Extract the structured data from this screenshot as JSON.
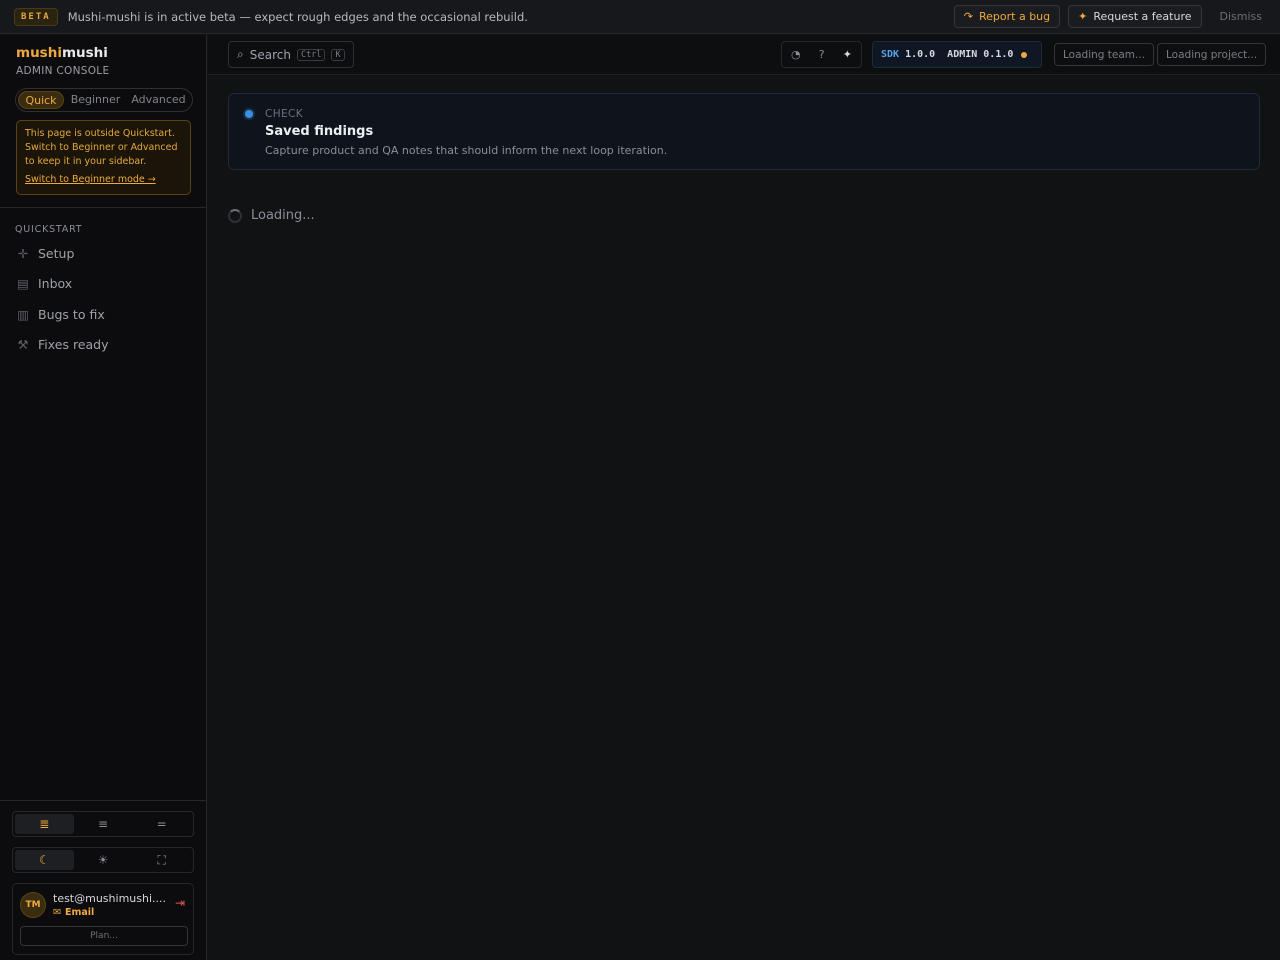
{
  "banner": {
    "badge": "BETA",
    "text": "Mushi-mushi is in active beta — expect rough edges and the occasional rebuild.",
    "report_bug": "Report a bug",
    "request_feature": "Request a feature",
    "dismiss": "Dismiss"
  },
  "sidebar": {
    "brand_a": "mushi",
    "brand_b": "mushi",
    "brand_sub": "ADMIN CONSOLE",
    "modes": [
      "Quick",
      "Beginner",
      "Advanced"
    ],
    "notice_text": "This page is outside Quickstart. Switch to Beginner or Advanced to keep it in your sidebar.",
    "notice_link": "Switch to Beginner mode →",
    "section_title": "QUICKSTART",
    "items": [
      {
        "label": "Setup",
        "icon": "sparkle-icon"
      },
      {
        "label": "Inbox",
        "icon": "inbox-icon"
      },
      {
        "label": "Bugs to fix",
        "icon": "document-icon"
      },
      {
        "label": "Fixes ready",
        "icon": "wrench-icon"
      }
    ]
  },
  "user": {
    "initials": "TM",
    "email": "test@mushimushi....",
    "method": "Email",
    "plan": "Plan..."
  },
  "topbar": {
    "search_label": "Search",
    "kbd_ctrl": "Ctrl",
    "kbd_k": "K",
    "sdk_label": "SDK",
    "sdk_version": "1.0.0",
    "admin_label": "ADMIN",
    "admin_version": "0.1.0",
    "loading_team": "Loading team...",
    "loading_project": "Loading project..."
  },
  "check": {
    "label": "CHECK",
    "title": "Saved findings",
    "description": "Capture product and QA notes that should inform the next loop iteration."
  },
  "main": {
    "loading_text": "Loading..."
  },
  "colors": {
    "accent": "#f0a93e",
    "info": "#3b8fe0",
    "background": "#111214"
  }
}
